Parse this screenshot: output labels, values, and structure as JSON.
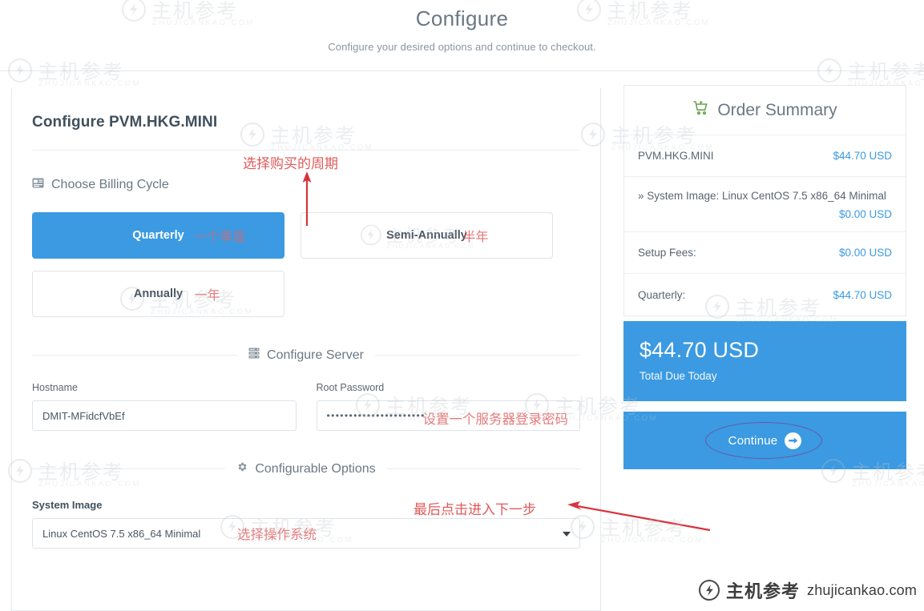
{
  "page": {
    "title": "Configure",
    "subtitle": "Configure your desired options and continue to checkout."
  },
  "configure": {
    "heading": "Configure PVM.HKG.MINI",
    "billing_section": {
      "icon": "credit-card-icon",
      "label": "Choose Billing Cycle",
      "options": [
        {
          "label": "Quarterly",
          "note": "一个季度",
          "selected": true
        },
        {
          "label": "Semi-Annually",
          "note": "半年",
          "selected": false
        },
        {
          "label": "Annually",
          "note": "一年",
          "selected": false
        }
      ]
    },
    "server_section": {
      "icon": "server-rack-icon",
      "label": "Configure Server",
      "hostname_label": "Hostname",
      "hostname_value": "DMIT-MFidcfVbEf",
      "password_label": "Root Password",
      "password_value": "••••••••••••••••••••••",
      "password_note": "设置一个服务器登录密码"
    },
    "options_section": {
      "icon": "gear-icon",
      "label": "Configurable Options",
      "system_image_label": "System Image",
      "system_image_value": "Linux CentOS 7.5 x86_64 Minimal",
      "system_image_note": "选择操作系统",
      "caret": "chevron-down-icon"
    }
  },
  "order_summary": {
    "icon": "shopping-cart-icon",
    "title": "Order Summary",
    "rows": [
      {
        "label": "PVM.HKG.MINI",
        "price": "$44.70 USD",
        "style": "inline"
      },
      {
        "label": "» System Image: Linux CentOS 7.5 x86_64 Minimal",
        "price": "$0.00 USD",
        "style": "stack"
      },
      {
        "label": "Setup Fees:",
        "price": "$0.00 USD",
        "style": "inline"
      },
      {
        "label": "Quarterly:",
        "price": "$44.70 USD",
        "style": "inline"
      }
    ],
    "total_amount": "$44.70 USD",
    "total_label": "Total Due Today",
    "continue_label": "Continue",
    "continue_arrow": "arrow-right-circle-icon"
  },
  "annotations": {
    "billing_cycle": "选择购买的周期",
    "continue_step": "最后点击进入下一步"
  },
  "brand": {
    "cn": "主机参考",
    "domain": "zhujicankao.com",
    "watermark_cn": "主机参考",
    "watermark_en": "ZHUJICANKAO.COM"
  },
  "colors": {
    "accent": "#3b9ae1",
    "annotation_red": "#e0595a",
    "annotation_purple": "#7b3f8f",
    "text_dark": "#41505c",
    "text_muted": "#6b7884"
  }
}
